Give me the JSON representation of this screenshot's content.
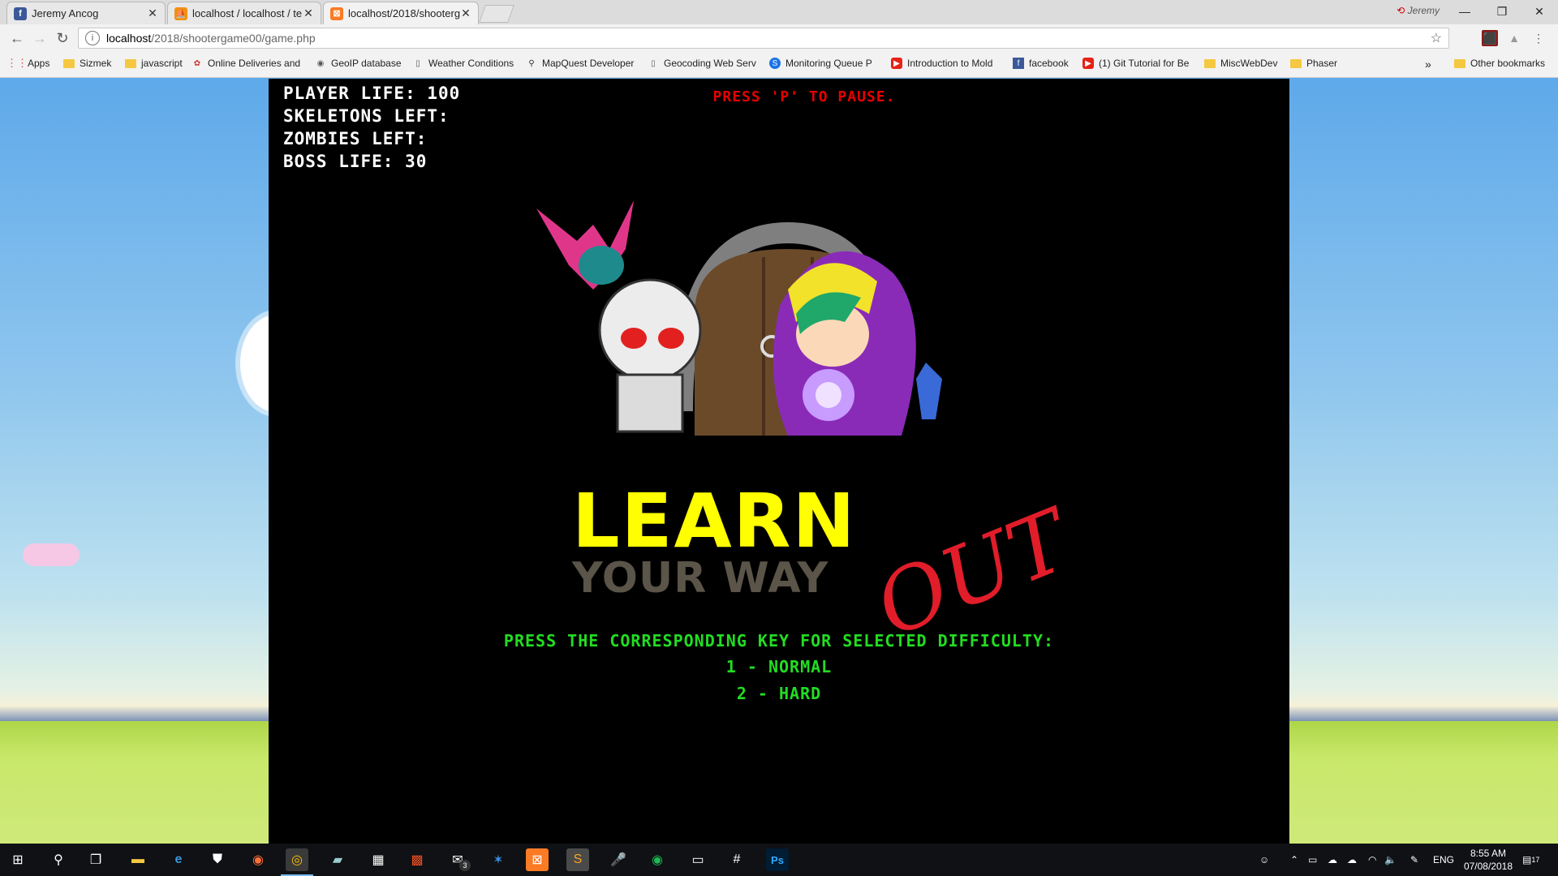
{
  "browser": {
    "tabs": [
      {
        "title": "Jeremy Ancog",
        "icon": "facebook-icon",
        "active": false
      },
      {
        "title": "localhost / localhost / te",
        "icon": "phpmyadmin-icon",
        "active": false
      },
      {
        "title": "localhost/2018/shooterg",
        "icon": "xampp-icon",
        "active": true
      }
    ],
    "profile_name": "Jeremy",
    "url_host": "localhost",
    "url_path": "/2018/shootergame00/game.php",
    "bookmarks": [
      {
        "label": "Apps",
        "icon": "apps-grid-icon"
      },
      {
        "label": "Sizmek",
        "icon": "folder-icon"
      },
      {
        "label": "javascript",
        "icon": "folder-icon"
      },
      {
        "label": "Online Deliveries and",
        "icon": "delivery-icon"
      },
      {
        "label": "GeoIP database",
        "icon": "globe-icon"
      },
      {
        "label": "Weather Conditions",
        "icon": "page-icon"
      },
      {
        "label": "MapQuest Developer",
        "icon": "mapquest-icon"
      },
      {
        "label": "Geocoding Web Serv",
        "icon": "page-icon"
      },
      {
        "label": "Monitoring Queue P",
        "icon": "s-icon"
      },
      {
        "label": "Introduction to Mold",
        "icon": "youtube-icon"
      },
      {
        "label": "facebook",
        "icon": "facebook-icon"
      },
      {
        "label": "(1) Git Tutorial for Be",
        "icon": "youtube-icon"
      },
      {
        "label": "MiscWebDev",
        "icon": "folder-icon"
      },
      {
        "label": "Phaser",
        "icon": "folder-icon"
      }
    ],
    "more_bookmarks": "»",
    "other_bookmarks": "Other bookmarks"
  },
  "game": {
    "hud": {
      "player_life": "PLAYER LIFE: 100",
      "skeletons_left": "SKELETONS LEFT:",
      "zombies_left": "ZOMBIES LEFT:",
      "boss_life": "BOSS LIFE: 30"
    },
    "pause_hint": "PRESS 'P' TO PAUSE.",
    "logo": {
      "line1": "LEARN",
      "line2": "YOUR WAY",
      "accent": "OUT"
    },
    "difficulty_prompt": "PRESS THE CORRESPONDING KEY FOR SELECTED DIFFICULTY:",
    "options": [
      "1 - NORMAL",
      "2 - HARD"
    ]
  },
  "taskbar": {
    "language": "ENG",
    "time": "8:55 AM",
    "date": "07/08/2018",
    "notification_count": "17",
    "mail_badge": "3"
  },
  "colors": {
    "hud_text": "#ffffff",
    "pause_text": "#e60000",
    "prompt_text": "#22dd22",
    "logo_yellow": "#ffff00",
    "logo_out": "#e11d2a"
  }
}
